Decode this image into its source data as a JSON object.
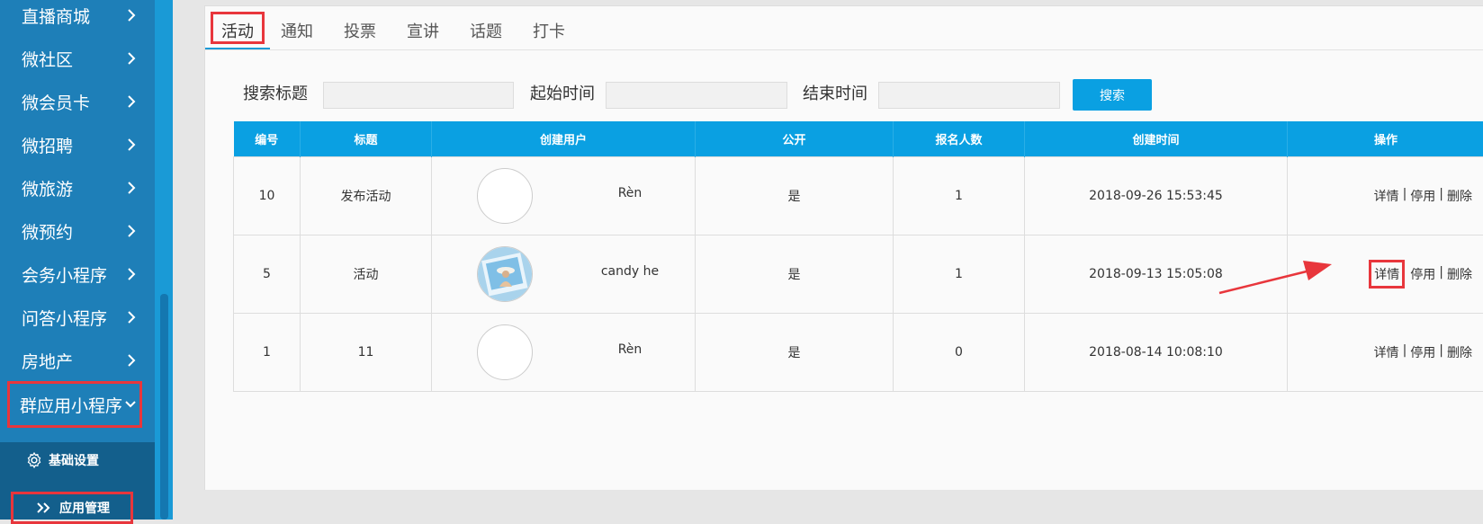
{
  "sidebar": {
    "items": [
      {
        "label": "直播商城"
      },
      {
        "label": "微社区"
      },
      {
        "label": "微会员卡"
      },
      {
        "label": "微招聘"
      },
      {
        "label": "微旅游"
      },
      {
        "label": "微预约"
      },
      {
        "label": "会务小程序"
      },
      {
        "label": "问答小程序"
      },
      {
        "label": "房地产"
      }
    ],
    "active_group": {
      "label": "群应用小程序"
    },
    "sub_items": [
      {
        "label": "基础设置"
      },
      {
        "label": "应用管理"
      }
    ]
  },
  "tabs": [
    {
      "label": "活动"
    },
    {
      "label": "通知"
    },
    {
      "label": "投票"
    },
    {
      "label": "宣讲"
    },
    {
      "label": "话题"
    },
    {
      "label": "打卡"
    }
  ],
  "search": {
    "title_label": "搜索标题",
    "title_value": "",
    "start_label": "起始时间",
    "start_value": "",
    "end_label": "结束时间",
    "end_value": "",
    "button_label": "搜索"
  },
  "table": {
    "columns": [
      "编号",
      "标题",
      "创建用户",
      "公开",
      "报名人数",
      "创建时间",
      "操作"
    ],
    "rows": [
      {
        "id": "10",
        "title": "发布活动",
        "user": "Rèn",
        "public": "是",
        "count": "1",
        "created": "2018-09-26 15:53:45"
      },
      {
        "id": "5",
        "title": "活动",
        "user": "candy he",
        "public": "是",
        "count": "1",
        "created": "2018-09-13 15:05:08"
      },
      {
        "id": "1",
        "title": "11",
        "user": "Rèn",
        "public": "是",
        "count": "0",
        "created": "2018-08-14 10:08:10"
      }
    ],
    "ops": {
      "detail": "详情",
      "disable": "停用",
      "delete": "删除",
      "sep": "|"
    }
  },
  "colors": {
    "sidebar": "#1e7fb8",
    "accent": "#0aa0e2",
    "highlight": "#e8363c"
  }
}
